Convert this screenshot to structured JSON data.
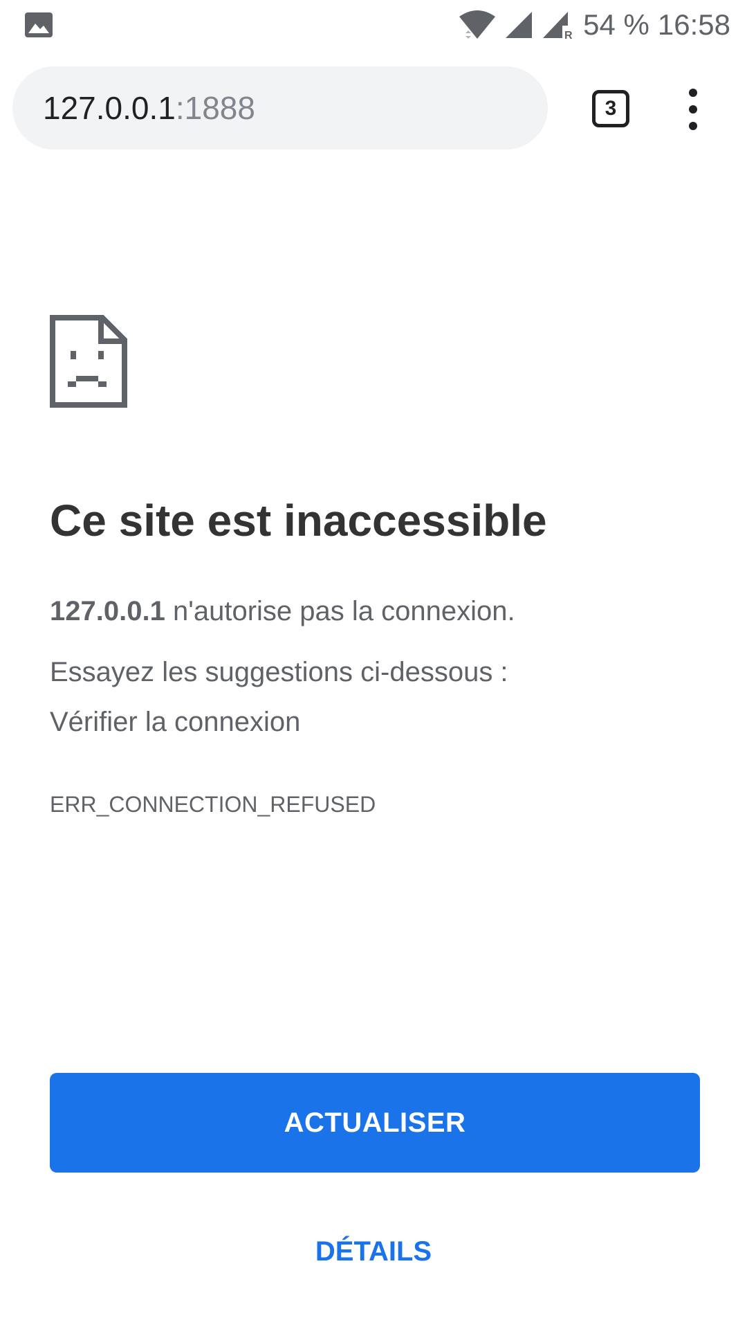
{
  "status_bar": {
    "left_icon": "image-notification-icon",
    "battery": "54 %",
    "time": "16:58",
    "icons": [
      "wifi-icon",
      "cell-signal-icon",
      "cell-signal-roaming-icon"
    ]
  },
  "toolbar": {
    "url_host": "127.0.0.1",
    "url_port": ":1888",
    "tab_count": "3",
    "menu_icon": "more-vert-icon"
  },
  "error": {
    "icon": "sad-page-icon",
    "title": "Ce site est inaccessible",
    "host": "127.0.0.1",
    "description": "n'autorise pas la connexion.",
    "suggestions_heading": "Essayez les suggestions ci-dessous :",
    "suggestions": [
      "Vérifier la connexion"
    ],
    "code": "ERR_CONNECTION_REFUSED"
  },
  "buttons": {
    "reload_label": "ACTUALISER",
    "details_label": "DÉTAILS"
  },
  "colors": {
    "accent": "#1a73e8",
    "text_primary": "#333333",
    "text_secondary": "#5f6368",
    "omnibox_bg": "#f1f3f4"
  }
}
